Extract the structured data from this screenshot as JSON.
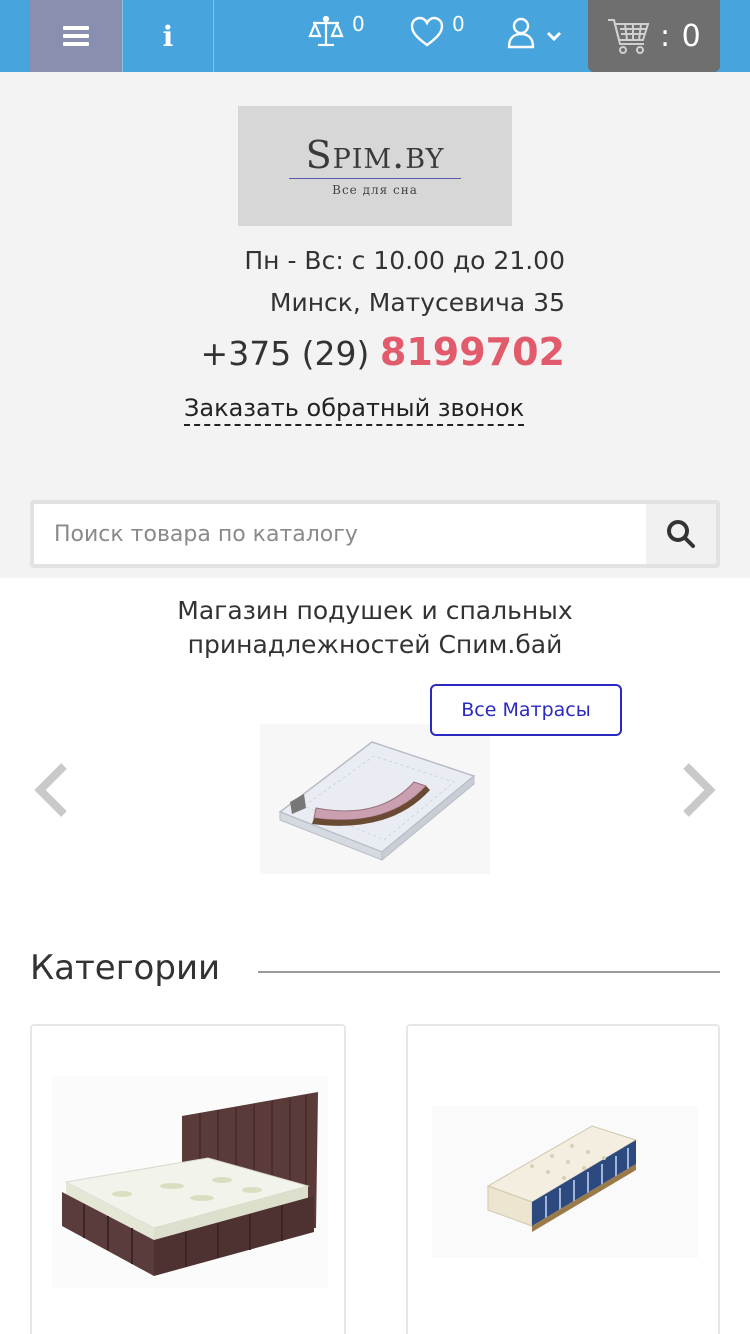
{
  "topbar": {
    "compare_count": "0",
    "wishlist_count": "0",
    "cart_count": ": 0",
    "icons": [
      "menu-icon",
      "info-icon",
      "scales-icon",
      "heart-icon",
      "user-icon",
      "chevron-down-icon",
      "cart-icon"
    ]
  },
  "logo": {
    "title": "Spim.by",
    "subtitle": "Все для сна"
  },
  "contacts": {
    "hours": "Пн - Вс: с 10.00 до 21.00",
    "address": "Минск, Матусевича 35",
    "phone_prefix": "+375 (29) ",
    "phone_number": "8199702",
    "callback": "Заказать обратный звонок"
  },
  "search": {
    "placeholder": "Поиск товара по каталогу"
  },
  "slider": {
    "tagline_line1": "Магазин подушек и спальных",
    "tagline_line2": "принадлежностей Спим.бай",
    "button_label": "Все Матрасы"
  },
  "categories": {
    "heading": "Категории"
  },
  "colors": {
    "topbar": "#48a4dc",
    "menu_button": "#8a8fb0",
    "cart_button": "#6f6f6f",
    "phone_accent": "#e25b6d",
    "button_border": "#2a2ac0"
  }
}
